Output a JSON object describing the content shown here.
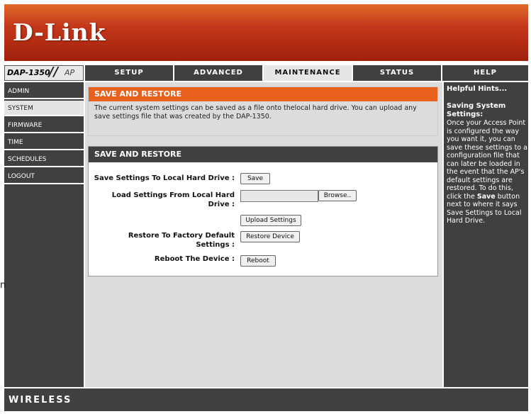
{
  "brand": {
    "logo_text": "D-Link"
  },
  "model": {
    "name": "DAP-1350",
    "slash": "//",
    "suffix": "AP"
  },
  "tabs": [
    {
      "label": "SETUP"
    },
    {
      "label": "ADVANCED"
    },
    {
      "label": "MAINTENANCE"
    },
    {
      "label": "STATUS"
    },
    {
      "label": "HELP"
    }
  ],
  "sidebar": {
    "items": [
      {
        "label": "ADMIN"
      },
      {
        "label": "SYSTEM"
      },
      {
        "label": "FIRMWARE"
      },
      {
        "label": "TIME"
      },
      {
        "label": "SCHEDULES"
      },
      {
        "label": "LOGOUT"
      }
    ]
  },
  "intro": {
    "title": "SAVE AND RESTORE",
    "text": "The current system settings can be saved as a file onto thelocal hard drive. You can upload any save settings file that was created by the DAP-1350."
  },
  "panel": {
    "title": "SAVE AND RESTORE",
    "save_label": "Save Settings To Local Hard Drive :",
    "save_button": "Save",
    "load_label": "Load Settings From Local Hard Drive :",
    "browse_button": "Browse..",
    "upload_button": "Upload Settings",
    "restore_label": "Restore To Factory Default Settings :",
    "restore_button": "Restore Device",
    "reboot_label": "Reboot The Device :",
    "reboot_button": "Reboot"
  },
  "hints": {
    "title": "Helpful Hints...",
    "subtitle": "Saving System Settings:",
    "body_before": "Once your Access Point is configured the way you want it, you can save these settings to a configuration file that can later be loaded in the event that the AP's default settings are restored. To do this, click the ",
    "body_bold": "Save",
    "body_after": " button next to where it says Save Settings to Local Hard Drive."
  },
  "footer": {
    "label": "WIRELESS"
  },
  "stray": {
    "text": "n"
  },
  "colors": {
    "orange": "#e8601e",
    "dark_gray": "#404040",
    "header_red": "#b8301a"
  }
}
